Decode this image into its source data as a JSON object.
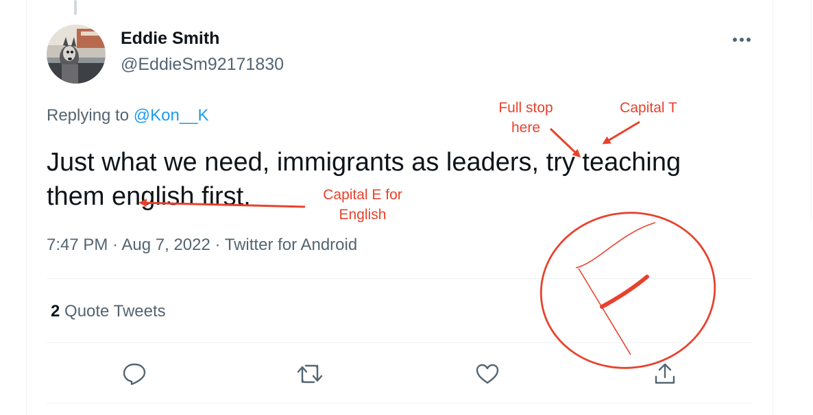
{
  "tweet": {
    "author_name": "Eddie Smith",
    "author_handle": "@EddieSm92171830",
    "replying_prefix": "Replying to ",
    "replying_handle": "@Kon__K",
    "text_line1": "Just what we need, immigrants as leaders, try teaching",
    "text_line2": "them english first.",
    "time": "7:47 PM",
    "separator": " · ",
    "date": "Aug 7, 2022",
    "client": "Twitter for Android",
    "quote_count": "2",
    "quote_label": " Quote Tweets"
  },
  "annotations": {
    "full_stop_line1": "Full stop",
    "full_stop_line2": "here",
    "capital_t": "Capital T",
    "capital_e_line1": "Capital E for",
    "capital_e_line2": "English",
    "grade": "F"
  },
  "actions": [
    "reply-icon",
    "retweet-icon",
    "like-icon",
    "share-icon"
  ],
  "colors": {
    "annotation_red": "#e8412c",
    "link_blue": "#1d9bf0",
    "secondary_text": "#536471",
    "primary_text": "#0f1419"
  }
}
